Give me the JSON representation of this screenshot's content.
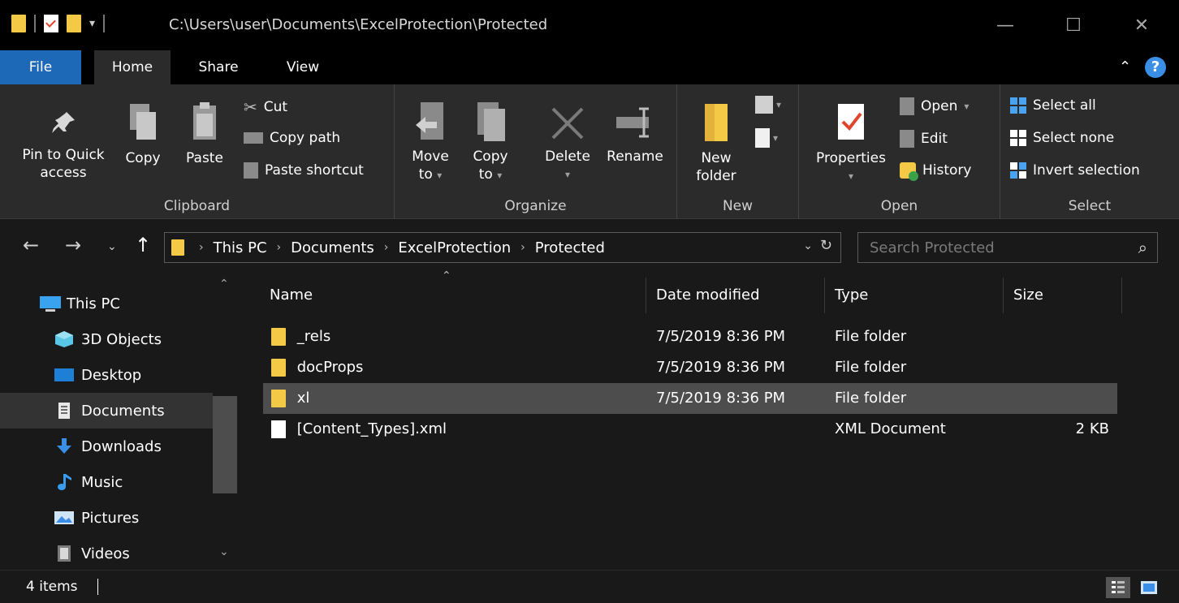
{
  "titlebar": {
    "path": "C:\\Users\\user\\Documents\\ExcelProtection\\Protected",
    "minimize": "—",
    "maximize": "☐",
    "close": "✕"
  },
  "tabs": {
    "file": "File",
    "home": "Home",
    "share": "Share",
    "view": "View"
  },
  "ribbon": {
    "clipboard": {
      "label": "Clipboard",
      "pin_line1": "Pin to Quick",
      "pin_line2": "access",
      "copy": "Copy",
      "paste": "Paste",
      "cut": "Cut",
      "copy_path": "Copy path",
      "paste_shortcut": "Paste shortcut"
    },
    "organize": {
      "label": "Organize",
      "move_line1": "Move",
      "move_line2": "to",
      "copy_line1": "Copy",
      "copy_line2": "to",
      "delete": "Delete",
      "rename": "Rename"
    },
    "new": {
      "label": "New",
      "new_folder_line1": "New",
      "new_folder_line2": "folder"
    },
    "open": {
      "label": "Open",
      "properties": "Properties",
      "open": "Open",
      "edit": "Edit",
      "history": "History"
    },
    "select": {
      "label": "Select",
      "select_all": "Select all",
      "select_none": "Select none",
      "invert": "Invert selection"
    }
  },
  "address": {
    "crumbs": [
      "This PC",
      "Documents",
      "ExcelProtection",
      "Protected"
    ],
    "search_placeholder": "Search Protected"
  },
  "navpane": {
    "items": [
      {
        "label": "This PC",
        "icon": "monitor-icon"
      },
      {
        "label": "3D Objects",
        "icon": "cube-icon"
      },
      {
        "label": "Desktop",
        "icon": "desktop-icon"
      },
      {
        "label": "Documents",
        "icon": "document-icon"
      },
      {
        "label": "Downloads",
        "icon": "download-icon"
      },
      {
        "label": "Music",
        "icon": "music-icon"
      },
      {
        "label": "Pictures",
        "icon": "pictures-icon"
      },
      {
        "label": "Videos",
        "icon": "video-icon"
      }
    ]
  },
  "filelist": {
    "columns": [
      "Name",
      "Date modified",
      "Type",
      "Size"
    ],
    "rows": [
      {
        "name": "_rels",
        "date": "7/5/2019 8:36 PM",
        "type": "File folder",
        "size": ""
      },
      {
        "name": "docProps",
        "date": "7/5/2019 8:36 PM",
        "type": "File folder",
        "size": ""
      },
      {
        "name": "xl",
        "date": "7/5/2019 8:36 PM",
        "type": "File folder",
        "size": ""
      },
      {
        "name": "[Content_Types].xml",
        "date": "",
        "type": "XML Document",
        "size": "2 KB"
      }
    ]
  },
  "status": {
    "count": "4 items"
  },
  "colors": {
    "accent": "#1e68b8",
    "folder": "#f4c945",
    "background": "#191919",
    "ribbon": "#2b2b2b"
  }
}
